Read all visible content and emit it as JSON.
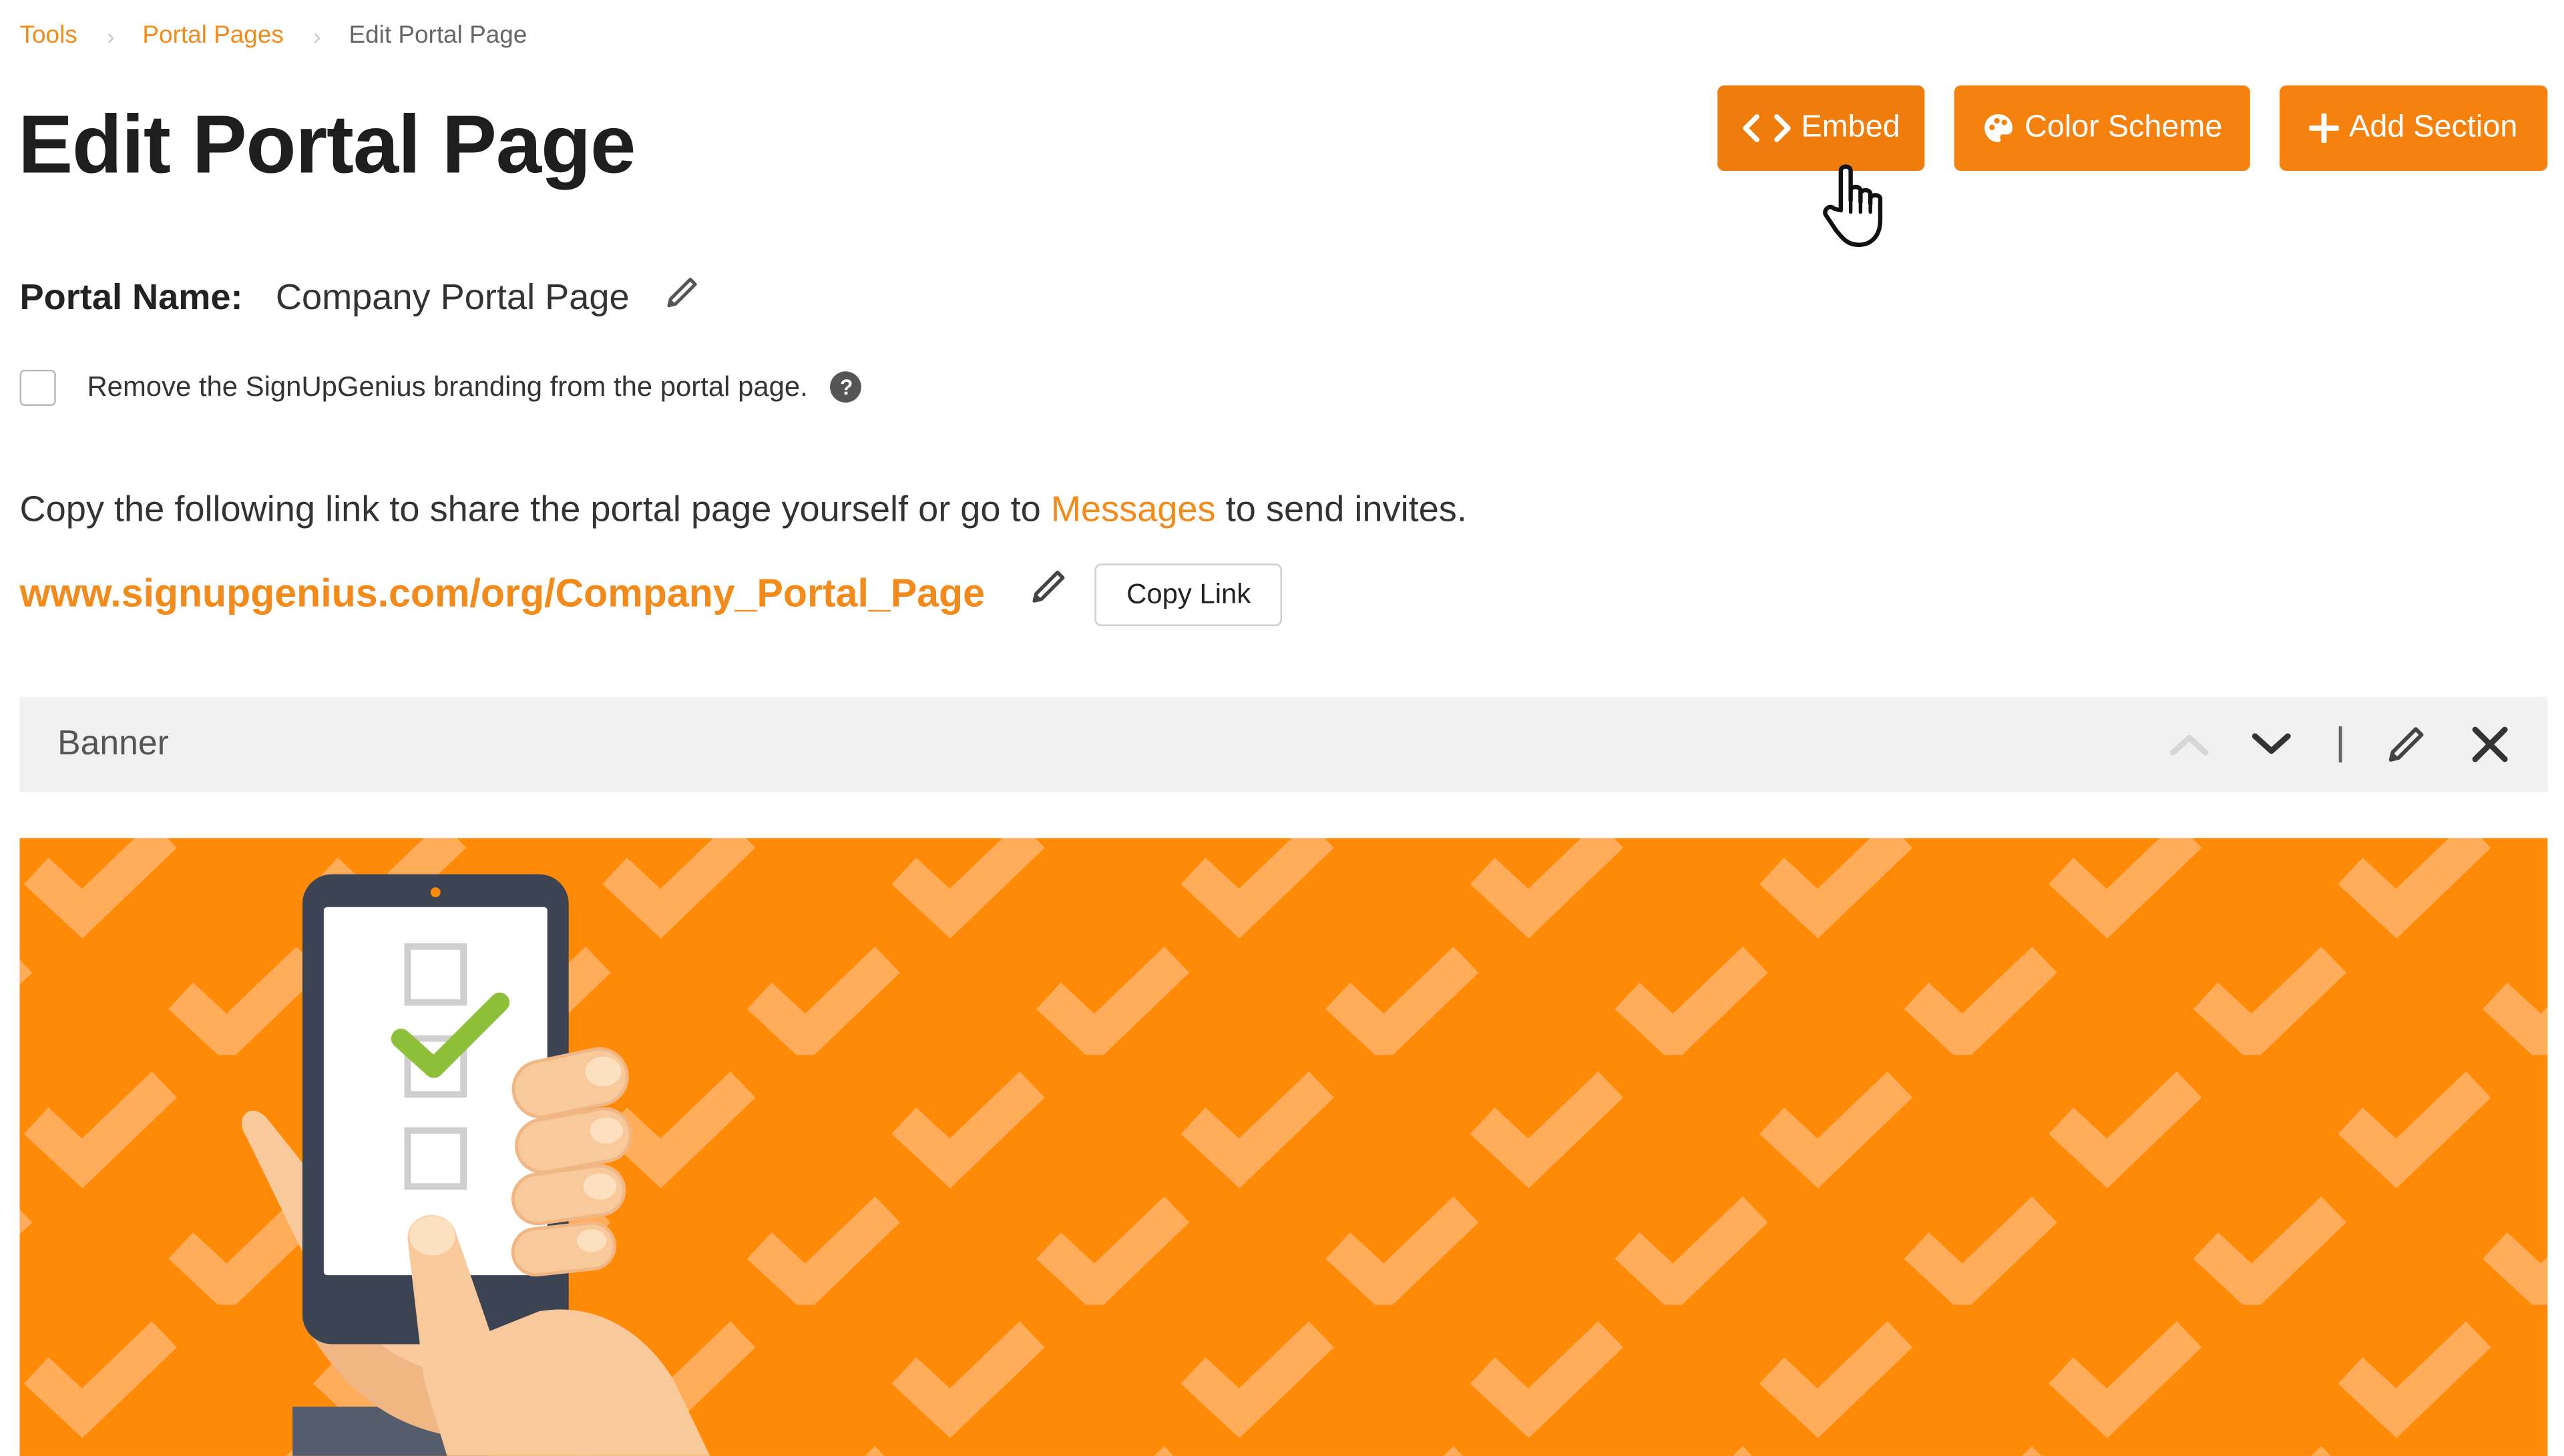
{
  "breadcrumb": {
    "items": [
      {
        "label": "Tools"
      },
      {
        "label": "Portal Pages"
      }
    ],
    "current": "Edit Portal Page"
  },
  "page": {
    "title": "Edit Portal Page"
  },
  "actions": {
    "embed_label": "Embed",
    "color_scheme_label": "Color Scheme",
    "add_section_label": "Add Section"
  },
  "portal": {
    "name_label": "Portal Name:",
    "name_value": "Company Portal Page"
  },
  "branding": {
    "checked": false,
    "label": "Remove the SignUpGenius branding from the portal page."
  },
  "share": {
    "text_before": "Copy the following link to share the portal page yourself or go to ",
    "messages_link": "Messages",
    "text_after": " to send invites.",
    "url": "www.signupgenius.com/org/Company_Portal_Page",
    "copy_label": "Copy Link"
  },
  "section": {
    "title": "Banner"
  },
  "icons": [
    "code-icon",
    "palette-icon",
    "plus-icon",
    "pencil-icon",
    "help-icon",
    "chevron-up-icon",
    "chevron-down-icon",
    "close-icon",
    "hand-cursor-icon"
  ],
  "colors": {
    "accent": "#f5820e",
    "banner_bg": "#ff8a07",
    "check_pattern": "#ffad5a",
    "checkmark_green": "#8dbf38",
    "section_bar": "#f1f1f1"
  }
}
